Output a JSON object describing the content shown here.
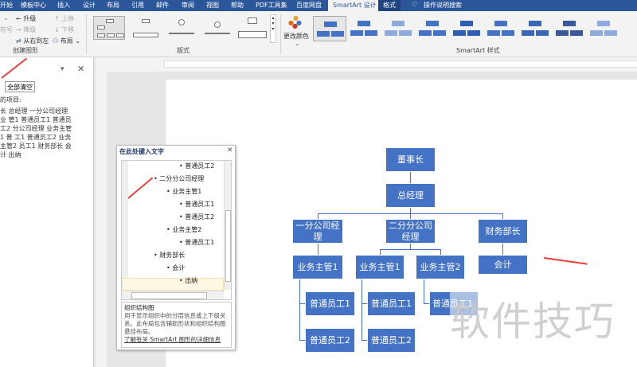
{
  "menu": {
    "tabs": [
      "开始",
      "模板中心",
      "插入",
      "设计",
      "布局",
      "引用",
      "邮件",
      "审阅",
      "视图",
      "帮助",
      "PDF工具集",
      "百度网盘",
      "SmartArt 设计",
      "格式"
    ],
    "search": "操作说明搜索",
    "active": "SmartArt 设计"
  },
  "ribbon": {
    "create": {
      "promote": "升级",
      "demote": "降级",
      "rtl": "从右到左",
      "move_up": "上移",
      "move_down": "下移",
      "layout": "布局",
      "bullet": "符号",
      "label": "创建图形"
    },
    "layouts_label": "版式",
    "change_colors": "更改颜色",
    "styles_label": "SmartArt 样式"
  },
  "left_pane": {
    "clear_all": "全部清空",
    "items_label": "的项目:",
    "items_text": "长 总经理 一分公司经理 业 管1 普通员工1 普通员工2 分公司经理 业务主管1 普 工1 普通员工2 业务主管2 员工1 财务部长 会计 出纳"
  },
  "text_pane": {
    "title": "在此处键入文字",
    "items": [
      {
        "text": "普通员工2",
        "level": 3
      },
      {
        "text": "二分分公司经理",
        "level": 1
      },
      {
        "text": "业务主管1",
        "level": 2
      },
      {
        "text": "普通员工1",
        "level": 3
      },
      {
        "text": "普通员工2",
        "level": 3
      },
      {
        "text": "业务主管2",
        "level": 2
      },
      {
        "text": "普通员工1",
        "level": 3
      },
      {
        "text": "财务部长",
        "level": 1
      },
      {
        "text": "会计",
        "level": 2
      },
      {
        "text": "出纳",
        "level": 3
      }
    ],
    "desc_title": "组织结构图",
    "desc": "用于显示组织中的分层信息或上下级关系。此布局包含辅助形状和组织结构图悬挂布局。",
    "link": "了解有关 SmartArt 图形的详细信息"
  },
  "org": {
    "chairman": "董事长",
    "gm": "总经理",
    "m1": "一分公司经理",
    "m2": "二分分公司经理",
    "finance": "财务部长",
    "s1": "业务主管1",
    "s2": "业务主管1",
    "s3": "业务主管2",
    "accountant": "会计",
    "e1": "普通员工1",
    "e2": "普通员工2",
    "e3": "普通员工1",
    "e4": "普通员工2",
    "e5": "普通员工1"
  },
  "watermark": "软件技巧"
}
